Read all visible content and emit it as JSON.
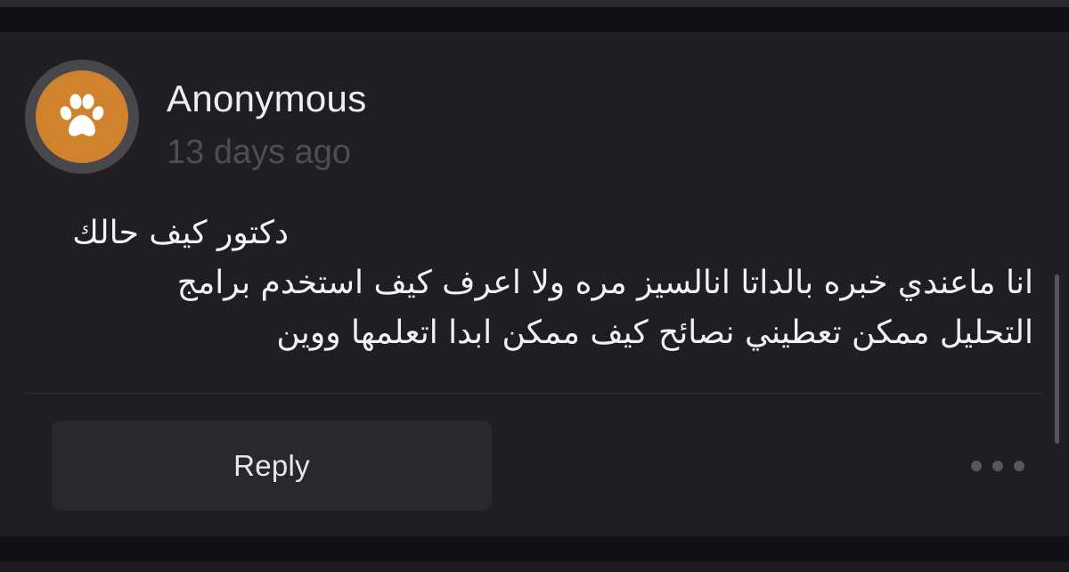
{
  "comment": {
    "avatar_icon": "paw-icon",
    "author": "Anonymous",
    "timestamp": "13 days ago",
    "message_lines": [
      "دكتور كيف حالك",
      "انا ماعندي خبره بالداتا انالسيز مره ولا اعرف كيف استخدم برامج",
      "التحليل ممكن تعطيني نصائح كيف ممكن ابدا اتعلمها ووين"
    ]
  },
  "actions": {
    "reply_label": "Reply",
    "more_icon": "ellipsis-icon"
  },
  "colors": {
    "background": "#1e1e23",
    "avatar": "#d0822c",
    "avatar_ring": "#47474c",
    "text": "#f2f2f2",
    "muted_text": "#4d4d53",
    "button": "#28282d"
  }
}
